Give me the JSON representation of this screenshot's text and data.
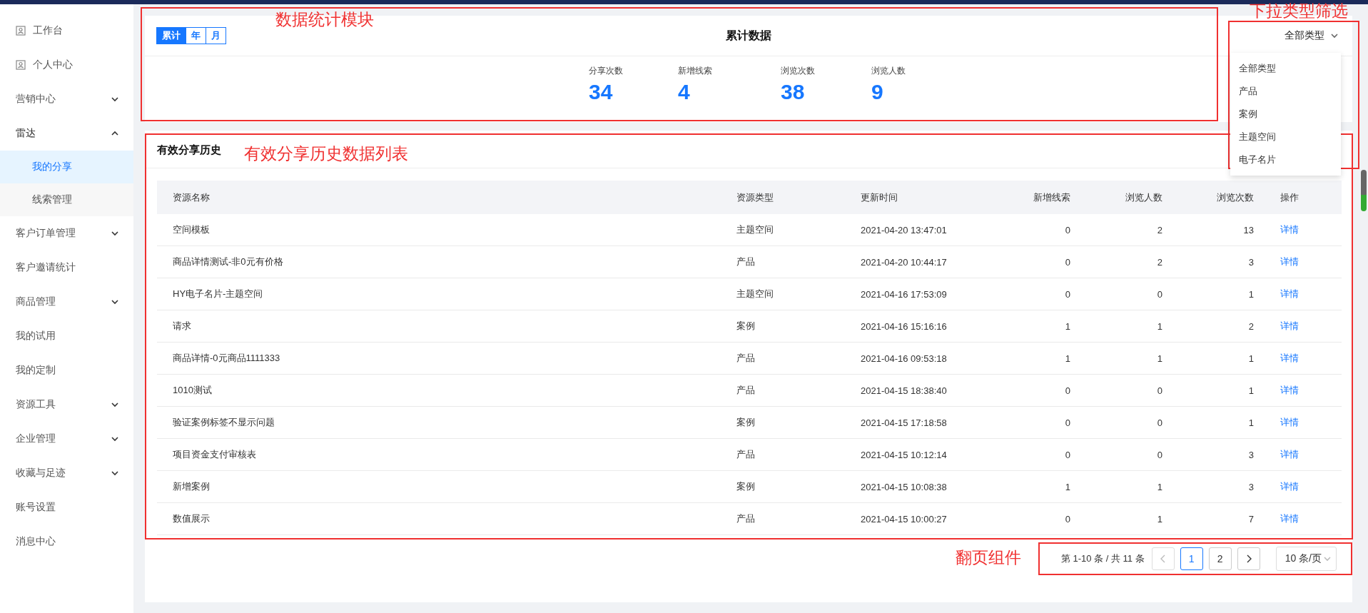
{
  "sidebar": {
    "items": [
      {
        "label": "工作台",
        "kind": "icon-link",
        "selected": false
      },
      {
        "label": "个人中心",
        "kind": "icon-link",
        "selected": false
      },
      {
        "label": "营销中心",
        "kind": "plain",
        "expanded": false,
        "selected": false
      },
      {
        "label": "雷达",
        "kind": "plain",
        "expanded": true,
        "selected": false,
        "children": [
          {
            "label": "我的分享",
            "selected": true
          },
          {
            "label": "线索管理",
            "selected": false
          }
        ]
      },
      {
        "label": "客户订单管理",
        "kind": "plain",
        "expanded": false,
        "selected": false
      },
      {
        "label": "客户邀请统计",
        "kind": "plain",
        "selected": false
      },
      {
        "label": "商品管理",
        "kind": "plain",
        "expanded": false,
        "selected": false
      },
      {
        "label": "我的试用",
        "kind": "plain",
        "selected": false
      },
      {
        "label": "我的定制",
        "kind": "plain",
        "selected": false
      },
      {
        "label": "资源工具",
        "kind": "plain",
        "expanded": false,
        "selected": false
      },
      {
        "label": "企业管理",
        "kind": "plain",
        "expanded": false,
        "selected": false
      },
      {
        "label": "收藏与足迹",
        "kind": "plain",
        "expanded": false,
        "selected": false
      },
      {
        "label": "账号设置",
        "kind": "plain",
        "selected": false
      },
      {
        "label": "消息中心",
        "kind": "plain",
        "selected": false
      }
    ]
  },
  "stats": {
    "title": "累计数据",
    "periods": [
      {
        "label": "累计",
        "selected": true
      },
      {
        "label": "年",
        "selected": false
      },
      {
        "label": "月",
        "selected": false
      }
    ],
    "metrics": [
      {
        "label": "分享次数",
        "value": "34"
      },
      {
        "label": "新增线索",
        "value": "4"
      },
      {
        "label": "浏览次数",
        "value": "38"
      },
      {
        "label": "浏览人数",
        "value": "9"
      }
    ],
    "filter": {
      "value": "全部类型",
      "expanded": true,
      "options": [
        "全部类型",
        "产品",
        "案例",
        "主题空间",
        "电子名片"
      ]
    }
  },
  "history": {
    "title": "有效分享历史",
    "columns": [
      "资源名称",
      "资源类型",
      "更新时间",
      "新增线索",
      "浏览人数",
      "浏览次数",
      "操作"
    ],
    "rows": [
      [
        "空间模板",
        "主题空间",
        "2021-04-20 13:47:01",
        "0",
        "2",
        "13",
        "详情"
      ],
      [
        "商品详情测试-非0元有价格",
        "产品",
        "2021-04-20 10:44:17",
        "0",
        "2",
        "3",
        "详情"
      ],
      [
        "HY电子名片-主题空间",
        "主题空间",
        "2021-04-16 17:53:09",
        "0",
        "0",
        "1",
        "详情"
      ],
      [
        "请求",
        "案例",
        "2021-04-16 15:16:16",
        "1",
        "1",
        "2",
        "详情"
      ],
      [
        "商品详情-0元商品1111333",
        "产品",
        "2021-04-16 09:53:18",
        "1",
        "1",
        "1",
        "详情"
      ],
      [
        "1010测试",
        "产品",
        "2021-04-15 18:38:40",
        "0",
        "0",
        "1",
        "详情"
      ],
      [
        "验证案例标签不显示问题",
        "案例",
        "2021-04-15 17:18:58",
        "0",
        "0",
        "1",
        "详情"
      ],
      [
        "项目资金支付审核表",
        "产品",
        "2021-04-15 10:12:14",
        "0",
        "0",
        "3",
        "详情"
      ],
      [
        "新增案例",
        "案例",
        "2021-04-15 10:08:38",
        "1",
        "1",
        "3",
        "详情"
      ],
      [
        "数值展示",
        "产品",
        "2021-04-15 10:00:27",
        "0",
        "1",
        "7",
        "详情"
      ]
    ],
    "pagination": {
      "summary": "第 1-10 条 / 共 11 条",
      "prev_disabled": true,
      "next_disabled": false,
      "pages": [
        {
          "label": "1",
          "selected": true
        },
        {
          "label": "2",
          "selected": false
        }
      ],
      "page_size": "10 条/页"
    }
  },
  "annotations": [
    {
      "label": "数据统计模块"
    },
    {
      "label": "下拉类型筛选"
    },
    {
      "label": "有效分享历史数据列表"
    },
    {
      "label": "翻页组件"
    }
  ]
}
